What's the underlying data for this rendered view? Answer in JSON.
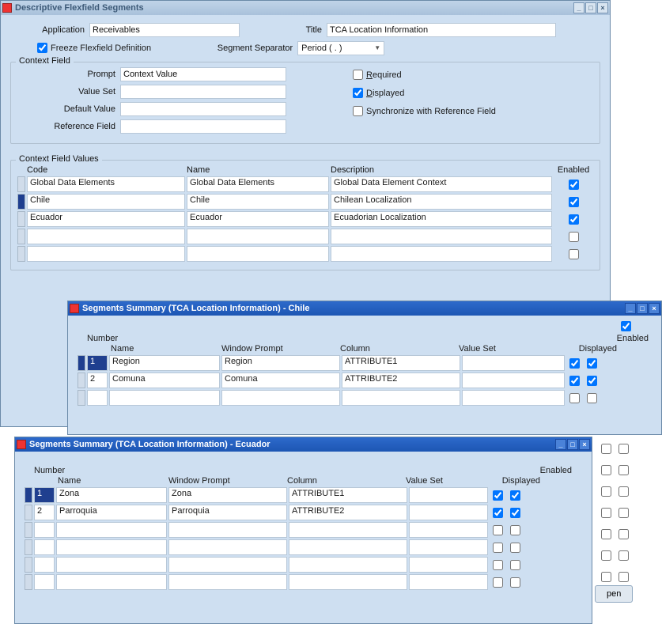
{
  "main": {
    "title": "Descriptive Flexfield Segments",
    "application_label": "Application",
    "application_value": "Receivables",
    "title_label": "Title",
    "title_value": "TCA Location Information",
    "freeze_label": "Freeze Flexfield Definition",
    "freeze_checked": true,
    "separator_label": "Segment Separator",
    "separator_value": "Period ( . )"
  },
  "context_field": {
    "group_title": "Context Field",
    "prompt_label": "Prompt",
    "prompt_value": "Context Value",
    "valueset_label": "Value Set",
    "valueset_value": "",
    "default_label": "Default Value",
    "default_value": "",
    "reference_label": "Reference Field",
    "reference_value": "",
    "required_label": "Required",
    "required_checked": false,
    "displayed_label": "Displayed",
    "displayed_checked": true,
    "sync_label": "Synchronize with Reference Field",
    "sync_checked": false
  },
  "context_values": {
    "group_title": "Context Field Values",
    "hdr_code": "Code",
    "hdr_name": "Name",
    "hdr_desc": "Description",
    "hdr_enabled": "Enabled",
    "rows": [
      {
        "code": "Global Data Elements",
        "name": "Global Data Elements",
        "desc": "Global Data Element Context",
        "enabled": true,
        "selected": false
      },
      {
        "code": "Chile",
        "name": "Chile",
        "desc": "Chilean Localization",
        "enabled": true,
        "selected": true
      },
      {
        "code": "Ecuador",
        "name": "Ecuador",
        "desc": "Ecuadorian Localization",
        "enabled": true,
        "selected": false
      },
      {
        "code": "",
        "name": "",
        "desc": "",
        "enabled": false,
        "selected": false
      },
      {
        "code": "",
        "name": "",
        "desc": "",
        "enabled": false,
        "selected": false
      }
    ]
  },
  "seg_chile": {
    "title": "Segments Summary (TCA Location Information) - Chile",
    "hdr_number": "Number",
    "hdr_name": "Name",
    "hdr_prompt": "Window Prompt",
    "hdr_column": "Column",
    "hdr_valueset": "Value Set",
    "hdr_enabled": "Enabled",
    "hdr_displayed": "Displayed",
    "rows": [
      {
        "num": "1",
        "name": "Region",
        "prompt": "Region",
        "column": "ATTRIBUTE1",
        "vs": "",
        "disp": true,
        "en": true,
        "selected": true
      },
      {
        "num": "2",
        "name": "Comuna",
        "prompt": "Comuna",
        "column": "ATTRIBUTE2",
        "vs": "",
        "disp": true,
        "en": true,
        "selected": false
      },
      {
        "num": "",
        "name": "",
        "prompt": "",
        "column": "",
        "vs": "",
        "disp": false,
        "en": false,
        "selected": false
      }
    ]
  },
  "seg_ecuador": {
    "title": "Segments Summary (TCA Location Information) - Ecuador",
    "hdr_number": "Number",
    "hdr_name": "Name",
    "hdr_prompt": "Window Prompt",
    "hdr_column": "Column",
    "hdr_valueset": "Value Set",
    "hdr_enabled": "Enabled",
    "hdr_displayed": "Displayed",
    "rows": [
      {
        "num": "1",
        "name": "Zona",
        "prompt": "Zona",
        "column": "ATTRIBUTE1",
        "vs": "",
        "disp": true,
        "en": true,
        "selected": true
      },
      {
        "num": "2",
        "name": "Parroquia",
        "prompt": "Parroquia",
        "column": "ATTRIBUTE2",
        "vs": "",
        "disp": true,
        "en": true,
        "selected": false
      },
      {
        "num": "",
        "name": "",
        "prompt": "",
        "column": "",
        "vs": "",
        "disp": false,
        "en": false,
        "selected": false
      },
      {
        "num": "",
        "name": "",
        "prompt": "",
        "column": "",
        "vs": "",
        "disp": false,
        "en": false,
        "selected": false
      },
      {
        "num": "",
        "name": "",
        "prompt": "",
        "column": "",
        "vs": "",
        "disp": false,
        "en": false,
        "selected": false
      },
      {
        "num": "",
        "name": "",
        "prompt": "",
        "column": "",
        "vs": "",
        "disp": false,
        "en": false,
        "selected": false
      }
    ]
  },
  "open_btn": "pen"
}
